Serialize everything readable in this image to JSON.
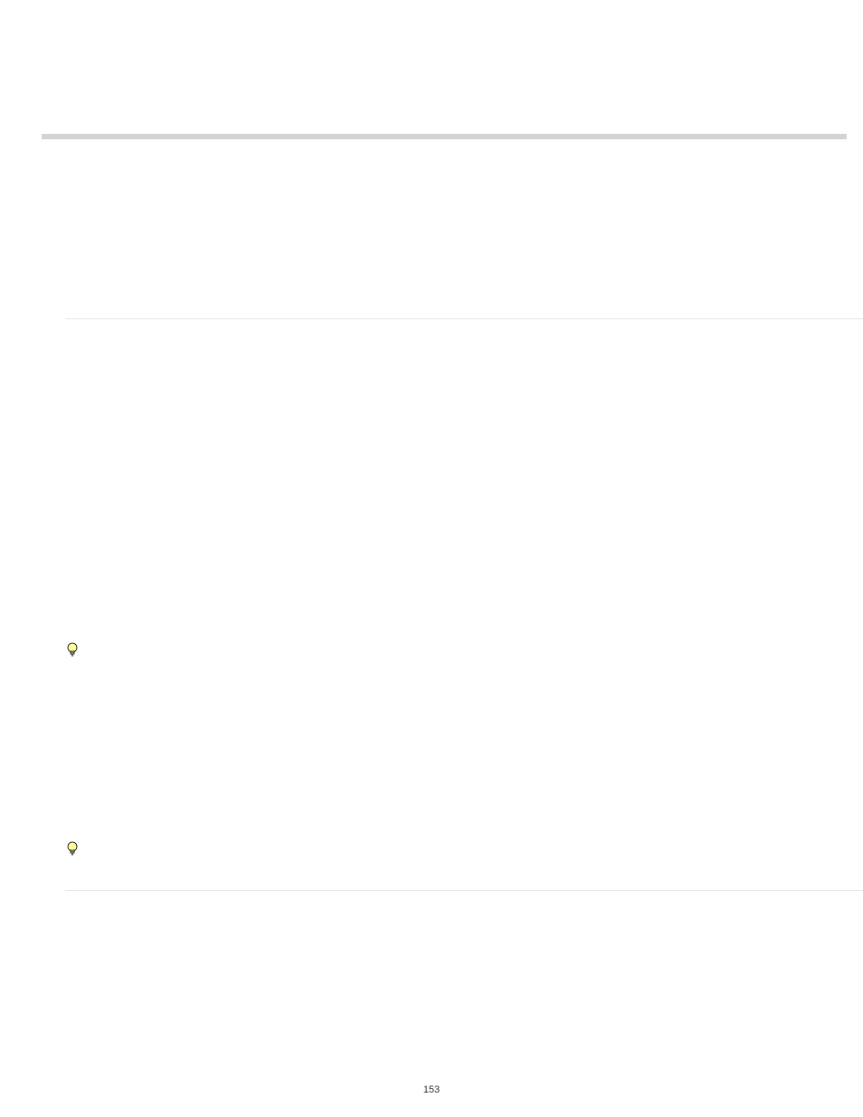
{
  "pageNumber": "153",
  "icons": {
    "tip1": "lightbulb-icon",
    "tip2": "lightbulb-icon"
  }
}
